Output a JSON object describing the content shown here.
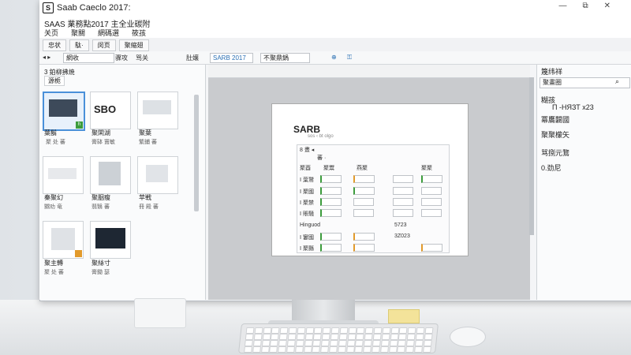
{
  "window": {
    "title": "Saab Caeclo 2017:",
    "logo_letter": "S",
    "controls": [
      "—",
      "⧉",
      "✕"
    ]
  },
  "menubar": {
    "heading": "SAAS 業務點2017 主全业碳附",
    "menus": [
      "关页",
      "聚關",
      "網碼選",
      "筱孩"
    ]
  },
  "tabs": [
    "忠状",
    "駄·",
    "闵页",
    "聚縮翅"
  ],
  "toolbar": {
    "nav": "◂ ▸",
    "field1": "網收",
    "item1": "骤攻",
    "item2": "骂关",
    "item3": "肚孃",
    "field2": "SARB 2017",
    "field3": "不聚鼎鍋",
    "zoom_label": "⊕"
  },
  "left_panel": {
    "header": "3 鉑柳拂焼",
    "filter": "源栀",
    "items": [
      {
        "label": "葉鬍",
        "sub": "聚 处 蕃",
        "status": "blue"
      },
      {
        "label": "聚閑湖",
        "sub": "膏缽 竇敏",
        "status": "green"
      },
      {
        "label": "聚葉",
        "sub": "繁鋪 蕃",
        "status": "green"
      },
      {
        "label": "秦聚幻",
        "sub": "嬲劝 竜",
        "status": "green"
      },
      {
        "label": "聚胭瘦",
        "sub": "翡翳 蕃",
        "status": "green"
      },
      {
        "label": "苹戦",
        "sub": "冊 殿 蕃",
        "status": "green"
      },
      {
        "label": "聚主轉",
        "sub": "聚 处 蕃",
        "status": "green"
      },
      {
        "label": "聚絲寸",
        "sub": "膏鋤 瑟",
        "status": "green"
      }
    ],
    "thumb_logo": "SBO"
  },
  "document": {
    "logo": "SARB",
    "subtitle": "sos ‹ bt olgo",
    "table_header": "8 晝 ◂",
    "filter_label": "蕃 ·",
    "col_headers": [
      "聚酉",
      "聚鬻",
      "燕聚",
      "聚聚"
    ],
    "rows": [
      "Ⅰ 葉鷲",
      "Ⅰ 聚國",
      "Ⅰ 聚禁",
      "Ⅰ 賬騒"
    ],
    "section": "Hinguod",
    "section_rows": [
      "Ⅰ 窶國",
      "Ⅰ 聚縣"
    ],
    "side_values": [
      "5723",
      "3Z023"
    ]
  },
  "right_panel": {
    "title": "篾纬祥",
    "search": "聚畫圈",
    "item1": "糊孩",
    "item1_sub": "П -НЯЗТ х23",
    "item2": "冪鷹闢國",
    "item3": "聚聚檬矢",
    "item4": "骂捌元鶩",
    "item5": "0.劲尼"
  },
  "colors": {
    "accent": "#4a90d9",
    "ok": "#3c9c3c",
    "warn": "#e29a2b"
  }
}
